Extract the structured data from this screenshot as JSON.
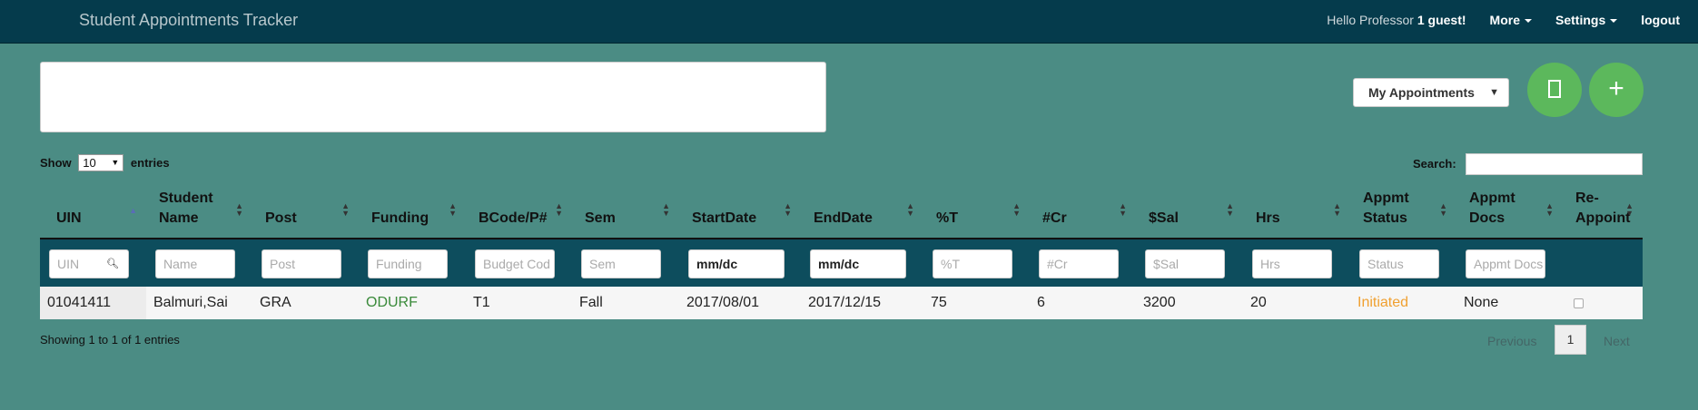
{
  "navbar": {
    "brand": "Student Appointments Tracker",
    "greeting_prefix": "Hello Professor",
    "greeting_user": "1 guest!",
    "more": "More",
    "settings": "Settings",
    "logout": "logout"
  },
  "filter_select": {
    "value": "My Appointments"
  },
  "fabs": {
    "doc_icon": "document-icon",
    "add_symbol": "+"
  },
  "length": {
    "show": "Show",
    "value": "10",
    "entries": "entries"
  },
  "search": {
    "label": "Search:"
  },
  "table": {
    "headers": [
      {
        "key": "uin",
        "l1": "UIN",
        "l2": ""
      },
      {
        "key": "name",
        "l1": "Student",
        "l2": "Name"
      },
      {
        "key": "post",
        "l1": "Post",
        "l2": ""
      },
      {
        "key": "funding",
        "l1": "Funding",
        "l2": ""
      },
      {
        "key": "bcode",
        "l1": "BCode/P#",
        "l2": ""
      },
      {
        "key": "sem",
        "l1": "Sem",
        "l2": ""
      },
      {
        "key": "start",
        "l1": "StartDate",
        "l2": ""
      },
      {
        "key": "end",
        "l1": "EndDate",
        "l2": ""
      },
      {
        "key": "pct",
        "l1": "%T",
        "l2": ""
      },
      {
        "key": "cr",
        "l1": "#Cr",
        "l2": ""
      },
      {
        "key": "sal",
        "l1": "$Sal",
        "l2": ""
      },
      {
        "key": "hrs",
        "l1": "Hrs",
        "l2": ""
      },
      {
        "key": "status",
        "l1": "Appmt",
        "l2": "Status"
      },
      {
        "key": "docs",
        "l1": "Appmt",
        "l2": "Docs"
      },
      {
        "key": "reappoint",
        "l1": "Re-",
        "l2": "Appoint"
      }
    ],
    "filter_placeholders": [
      "UIN",
      "Name",
      "Post",
      "Funding",
      "Budget Cod",
      "Sem",
      "mm/dc",
      "mm/dc",
      "%T",
      "#Cr",
      "$Sal",
      "Hrs",
      "Status",
      "Appmt Docs"
    ],
    "rows": [
      {
        "uin": "01041411",
        "name": "Balmuri,Sai",
        "post": "GRA",
        "funding": "ODURF",
        "bcode": "T1",
        "sem": "Fall",
        "start": "2017/08/01",
        "end": "2017/12/15",
        "pct": "75",
        "cr": "6",
        "sal": "3200",
        "hrs": "20",
        "status": "Initiated",
        "docs": "None",
        "reappoint": false
      }
    ]
  },
  "footer": {
    "info": "Showing 1 to 1 of 1 entries",
    "previous": "Previous",
    "page": "1",
    "next": "Next"
  },
  "colors": {
    "background": "#4b8c84",
    "navbar": "#053b4c",
    "filter_row": "#0d4d5d",
    "fab": "#5cb85c",
    "funding_text": "#3a8a3a",
    "status_text": "#f0a030"
  }
}
